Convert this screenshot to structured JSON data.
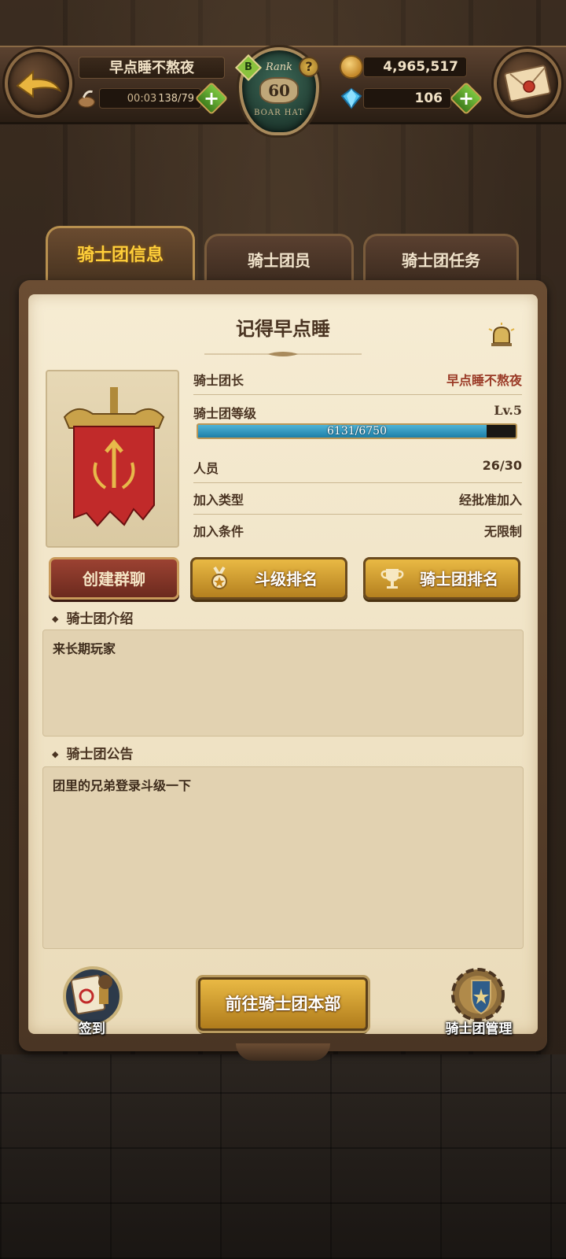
{
  "header": {
    "player_name": "早点睡不熬夜",
    "stamina_timer": "00:03",
    "stamina": "138/79",
    "rank_label": "Rank",
    "rank_value": "60",
    "rank_sub": "BOAR HAT",
    "rank_grade": "B",
    "rank_help": "?",
    "gold": "4,965,517",
    "gems": "106",
    "plus": "+"
  },
  "tabs": [
    {
      "label": "骑士团信息",
      "active": true
    },
    {
      "label": "骑士团员",
      "active": false
    },
    {
      "label": "骑士团任务",
      "active": false
    }
  ],
  "guild": {
    "name": "记得早点睡",
    "leader_label": "骑士团长",
    "leader_value": "早点睡不熬夜",
    "level_label": "骑士团等级",
    "level_value": "Lv.5",
    "xp_text": "6131/6750",
    "xp_fraction": 0.908,
    "members_label": "人员",
    "members_value": "26/30",
    "join_type_label": "加入类型",
    "join_type_value": "经批准加入",
    "join_cond_label": "加入条件",
    "join_cond_value": "无限制"
  },
  "buttons": {
    "create_chat": "创建群聊",
    "rank_fight": "斗级排名",
    "rank_guild": "骑士团排名",
    "checkin": "签到",
    "go_hq": "前往骑士团本部",
    "manage": "骑士团管理"
  },
  "intro": {
    "label": "骑士团介绍",
    "text": "来长期玩家"
  },
  "notice": {
    "label": "骑士团公告",
    "text": "团里的兄弟登录斗级一下"
  },
  "colors": {
    "accent_gold": "#ffcf3a",
    "leader_red": "#9a3a26",
    "xp_blue": "#2b95c0"
  }
}
